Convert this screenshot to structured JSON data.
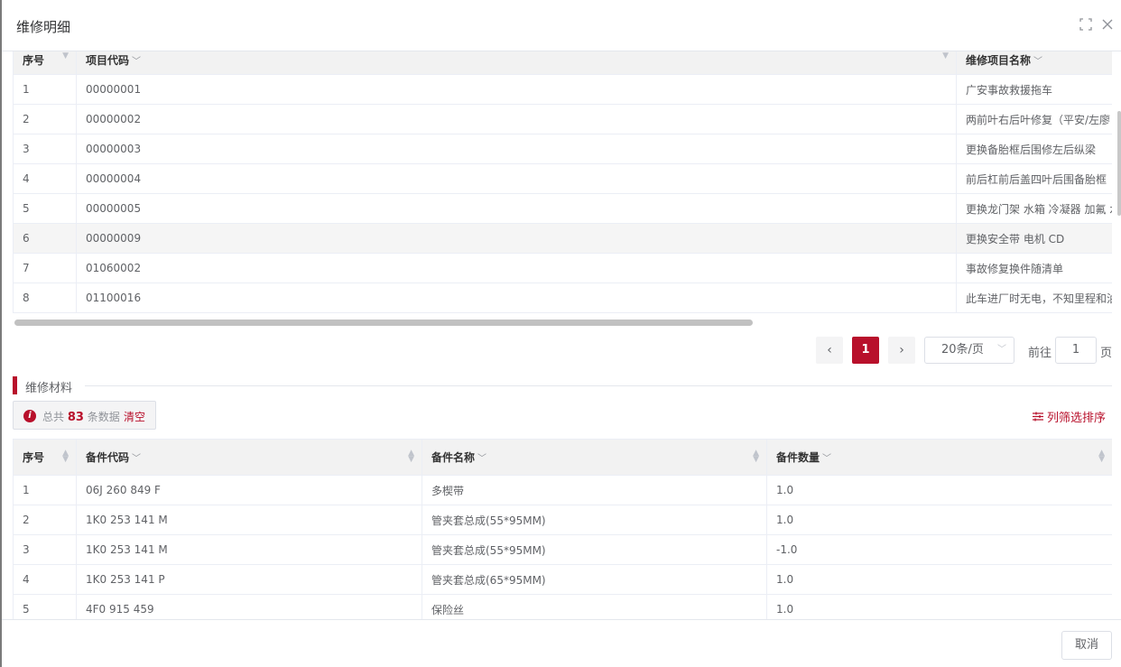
{
  "dialog": {
    "title": "维修明细",
    "cancel_label": "取消"
  },
  "items_table": {
    "headers": {
      "seq": "序号",
      "code": "项目代码",
      "name": "维修项目名称"
    },
    "rows": [
      {
        "seq": "1",
        "code": "00000001",
        "name": "广安事故救援拖车"
      },
      {
        "seq": "2",
        "code": "00000002",
        "name": "两前叶右后叶修复（平安/左廖"
      },
      {
        "seq": "3",
        "code": "00000003",
        "name": "更换备胎框后围修左后纵梁"
      },
      {
        "seq": "4",
        "code": "00000004",
        "name": "前后杠前后盖四叶后围备胎框"
      },
      {
        "seq": "5",
        "code": "00000005",
        "name": "更换龙门架 水箱 冷凝器 加氟 水"
      },
      {
        "seq": "6",
        "code": "00000009",
        "name": "更换安全带 电机 CD"
      },
      {
        "seq": "7",
        "code": "01060002",
        "name": "事故修复换件随清单"
      },
      {
        "seq": "8",
        "code": "01100016",
        "name": "此车进厂时无电，不知里程和油"
      }
    ]
  },
  "pagination": {
    "prev": "‹",
    "current_page": "1",
    "next": "›",
    "page_size": "20条/页",
    "goto_label": "前往",
    "goto_value": "1",
    "goto_unit": "页"
  },
  "materials": {
    "section_title": "维修材料",
    "summary_prefix": "总共",
    "total_count": "83",
    "summary_suffix": "条数据",
    "clear_label": "清空",
    "column_sort_label": "列筛选排序",
    "headers": {
      "seq": "序号",
      "code": "备件代码",
      "name": "备件名称",
      "qty": "备件数量"
    },
    "rows": [
      {
        "seq": "1",
        "code": "06J 260 849 F",
        "name": "多楔带",
        "qty": "1.0"
      },
      {
        "seq": "2",
        "code": "1K0 253 141 M",
        "name": "管夹套总成(55*95MM)",
        "qty": "1.0"
      },
      {
        "seq": "3",
        "code": "1K0 253 141 M",
        "name": "管夹套总成(55*95MM)",
        "qty": "-1.0"
      },
      {
        "seq": "4",
        "code": "1K0 253 141 P",
        "name": "管夹套总成(65*95MM)",
        "qty": "1.0"
      },
      {
        "seq": "5",
        "code": "4F0 915 459",
        "name": "保险丝",
        "qty": "1.0"
      }
    ]
  },
  "colors": {
    "accent": "#b8102b"
  }
}
